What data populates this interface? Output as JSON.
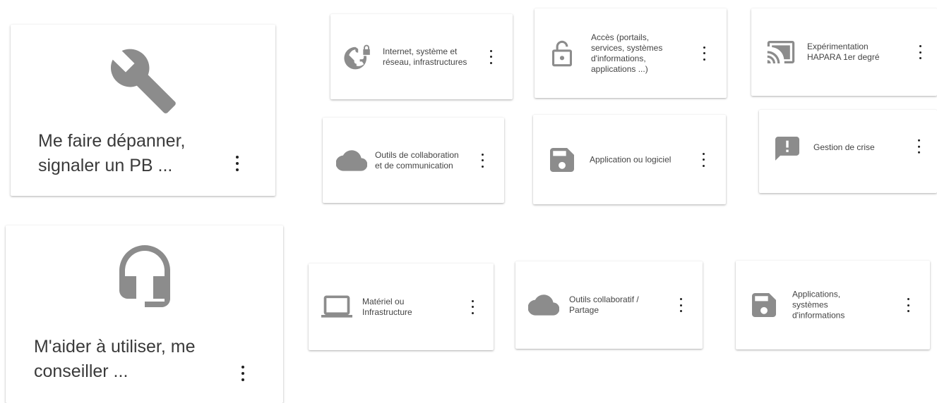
{
  "main_cards": [
    {
      "label_line1": "Me faire dépanner,",
      "label_line2": "signaler un PB ...",
      "icon": "wrench-icon"
    },
    {
      "label_line1": "M'aider à utiliser, me",
      "label_line2": "conseiller ...",
      "icon": "headset-icon"
    }
  ],
  "depanner_items": [
    {
      "icon": "globe-lock-icon",
      "lines": [
        "Internet, système et",
        "réseau, infrastructures"
      ]
    },
    {
      "icon": "unlock-icon",
      "lines": [
        "Accès (portails,",
        "services, systèmes",
        "d'informations,",
        "applications ...)"
      ]
    },
    {
      "icon": "cast-icon",
      "lines": [
        "Expérimentation",
        "HAPARA 1er degré"
      ]
    },
    {
      "icon": "cloud-icon",
      "lines": [
        "Outils de collaboration",
        "et de communication"
      ]
    },
    {
      "icon": "floppy-disk-icon",
      "lines": [
        "Application ou logiciel"
      ]
    },
    {
      "icon": "alert-message-icon",
      "lines": [
        "Gestion de crise"
      ]
    }
  ],
  "conseiller_items": [
    {
      "icon": "laptop-icon",
      "lines": [
        "Matériel ou",
        "Infrastructure"
      ]
    },
    {
      "icon": "cloud-icon",
      "lines": [
        "Outils collaboratif /",
        "Partage"
      ]
    },
    {
      "icon": "floppy-disk-icon",
      "lines": [
        "Applications,",
        "systèmes",
        "d'informations"
      ]
    }
  ],
  "colors": {
    "icon_gray": "#8c8c8c",
    "text": "#3a3a3a",
    "dots": "#222222"
  }
}
